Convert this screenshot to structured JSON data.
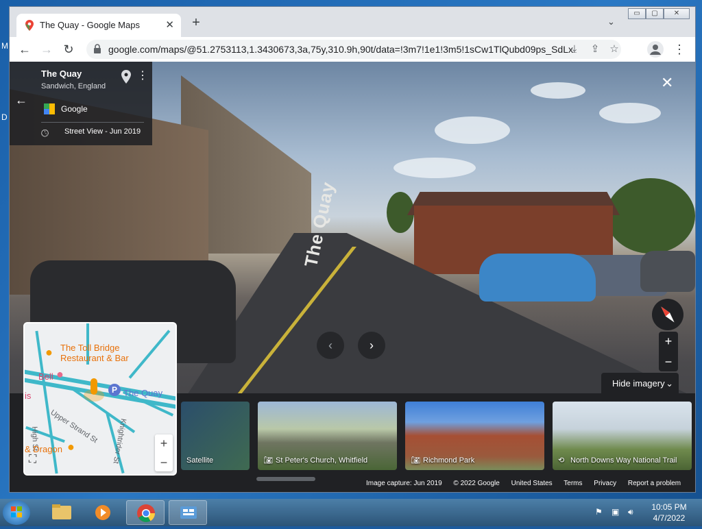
{
  "browser": {
    "tab_title": "The Quay - Google Maps",
    "tab_close": "✕",
    "new_tab": "+",
    "tab_dropdown": "⌄",
    "url": "google.com/maps/@51.2753113,1.3430673,3a,75y,310.9h,90t/data=!3m7!1e1!3m5!1sCw1TlQubd09ps_SdLx...",
    "window_controls": [
      "▭",
      "▢",
      "✕"
    ]
  },
  "streetview": {
    "place_title": "The Quay",
    "place_subtitle": "Sandwich, England",
    "source": "Google",
    "date_label": "Street View - Jun 2019",
    "road_marking": "The Quay",
    "hide_imagery": "Hide imagery",
    "zoom_in": "+",
    "zoom_out": "−"
  },
  "carousel": {
    "items": [
      {
        "label": "Satellite",
        "icon": "none"
      },
      {
        "label": "St Peter's Church, Whitfield",
        "icon": "camera-icon"
      },
      {
        "label": "Richmond Park",
        "icon": "camera-icon"
      },
      {
        "label": "North Downs Way National Trail",
        "icon": "360-icon"
      }
    ]
  },
  "footer": {
    "image_capture": "Image capture: Jun 2019",
    "copyright": "© 2022 Google",
    "country": "United States",
    "terms": "Terms",
    "privacy": "Privacy",
    "report": "Report a problem"
  },
  "minimap": {
    "labels": {
      "toll_bridge": "The Toll Bridge",
      "restaurant": "Restaurant & Bar",
      "bell": "Bell",
      "quay": "The Quay",
      "upper_strand": "Upper Strand St",
      "high_st": "High St",
      "knightrider": "Knightrider St",
      "dragon": "& Dragon",
      "is": "is"
    },
    "zoom_in": "+",
    "zoom_out": "−"
  },
  "taskbar": {
    "time": "10:05 PM",
    "date": "4/7/2022"
  },
  "colors": {
    "accent_blue": "#1a73e8",
    "minimap_road": "#3fb8c9",
    "pin_orange": "#f29900"
  }
}
